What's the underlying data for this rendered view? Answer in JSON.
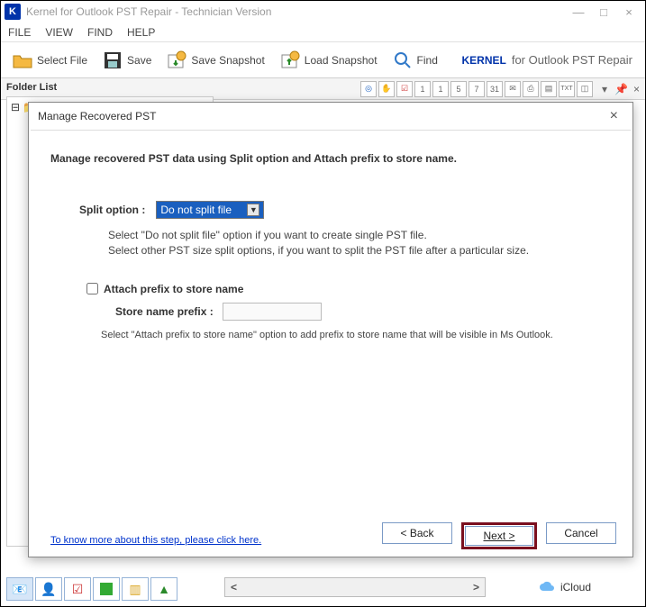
{
  "window": {
    "title": "Kernel for Outlook PST Repair - Technician Version"
  },
  "menu": {
    "items": [
      "FILE",
      "VIEW",
      "FIND",
      "HELP"
    ]
  },
  "toolbar": {
    "select_file": "Select File",
    "save": "Save",
    "save_snapshot": "Save Snapshot",
    "load_snapshot": "Load Snapshot",
    "find": "Find"
  },
  "brand": {
    "name": "KERNEL",
    "suffix": "for Outlook PST Repair"
  },
  "sidebar": {
    "label": "Folder List"
  },
  "icloud": {
    "label": "iCloud"
  },
  "dialog": {
    "title": "Manage Recovered PST",
    "heading": "Manage recovered PST data using Split option and Attach prefix to store name.",
    "split_label": "Split option :",
    "split_value": "Do not split file",
    "split_hint1": "Select \"Do not split file\" option if you want to create single PST file.",
    "split_hint2": "Select other PST size split options, if you want to split the PST file after a particular size.",
    "attach_label": "Attach prefix to store name",
    "prefix_label": "Store name prefix :",
    "prefix_value": "",
    "attach_hint": "Select \"Attach prefix to store name\" option to add prefix to store name that will be visible in Ms Outlook.",
    "know_more": "To know more about this step, please click here.",
    "back_label": "< Back",
    "next_label": "Next >",
    "cancel_label": "Cancel"
  },
  "small_toolbar_nums": [
    "1",
    "1",
    "5",
    "7",
    "31"
  ]
}
